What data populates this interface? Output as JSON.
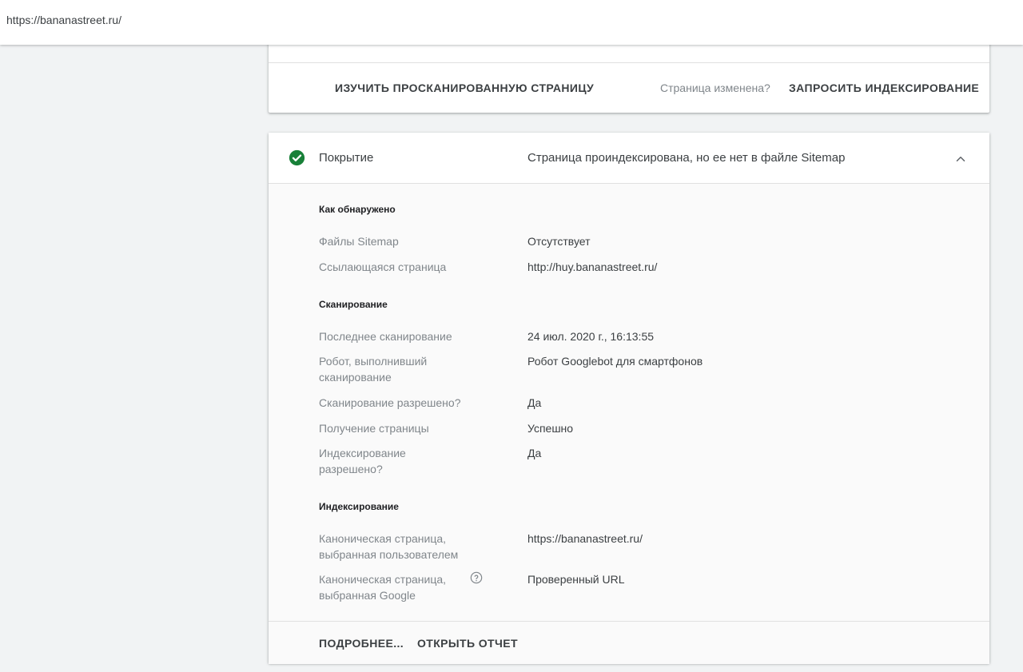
{
  "topbar": {
    "url": "https://bananastreet.ru/"
  },
  "top_card": {
    "inspect_button": "ИЗУЧИТЬ ПРОСКАНИРОВАННУЮ СТРАНИЦУ",
    "changed_label": "Страница изменена?",
    "request_button": "ЗАПРОСИТЬ ИНДЕКСИРОВАНИЕ"
  },
  "coverage": {
    "title": "Покрытие",
    "status": "Страница проиндексирована, но ее нет в файле Sitemap",
    "status_color": "#188038",
    "icons": {
      "status": "check-circle-icon",
      "toggle": "chevron-up-icon",
      "help": "help-circle-icon"
    },
    "discovery": {
      "heading": "Как обнаружено",
      "rows": [
        {
          "label": "Файлы Sitemap",
          "value": "Отсутствует"
        },
        {
          "label": "Ссылающаяся страница",
          "value": "http://huy.bananastreet.ru/"
        }
      ]
    },
    "crawl": {
      "heading": "Сканирование",
      "rows": [
        {
          "label": "Последнее сканирование",
          "value": "24 июл. 2020 г., 16:13:55"
        },
        {
          "label": "Робот, выполнивший сканирование",
          "value": "Робот Googlebot для смартфонов"
        },
        {
          "label": "Сканирование разрешено?",
          "value": "Да"
        },
        {
          "label": "Получение страницы",
          "value": "Успешно"
        },
        {
          "label": "Индексирование разрешено?",
          "value": "Да"
        }
      ]
    },
    "indexing": {
      "heading": "Индексирование",
      "rows": [
        {
          "label": "Каноническая страница, выбранная пользователем",
          "value": "https://bananastreet.ru/"
        },
        {
          "label": "Каноническая страница, выбранная Google",
          "value": "Проверенный URL"
        }
      ]
    },
    "footer": {
      "more_button": "ПОДРОБНЕЕ...",
      "report_button": "ОТКРЫТЬ ОТЧЕТ"
    }
  }
}
